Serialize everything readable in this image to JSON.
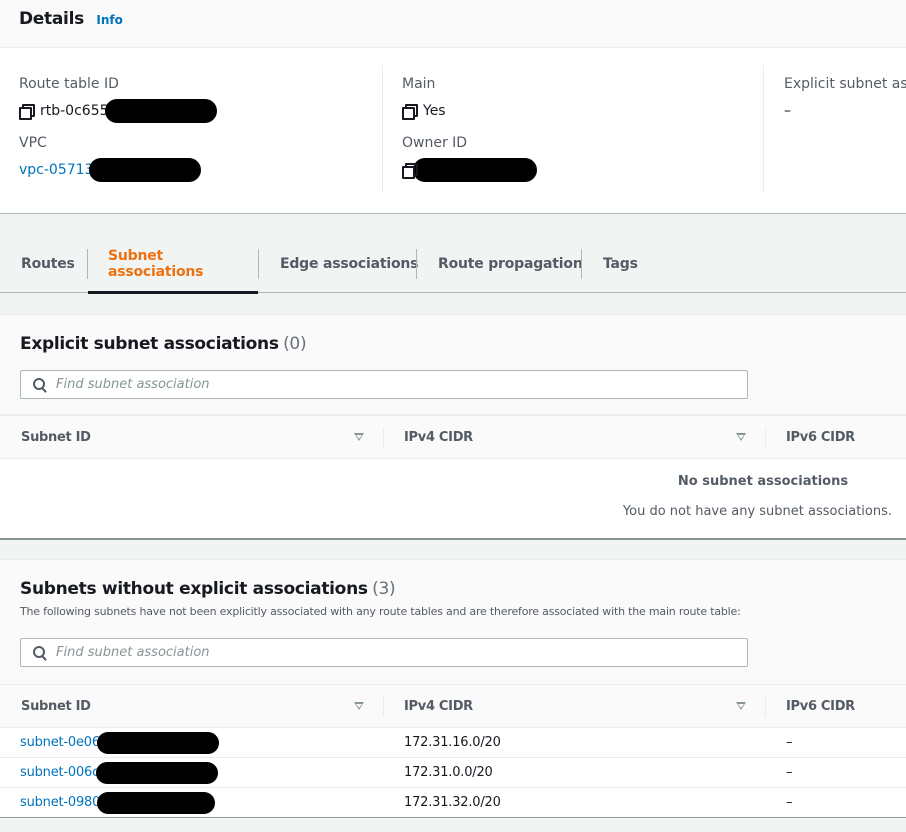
{
  "details": {
    "title": "Details",
    "info_label": "Info",
    "fields": {
      "route_table_id": {
        "label": "Route table ID",
        "value": "rtb-0c655"
      },
      "vpc": {
        "label": "VPC",
        "value": "vpc-05713"
      },
      "main": {
        "label": "Main",
        "value": "Yes"
      },
      "owner_id": {
        "label": "Owner ID",
        "value": ""
      },
      "explicit_subnet_associations": {
        "label": "Explicit subnet asso",
        "value": "–"
      }
    }
  },
  "tabs": [
    {
      "label": "Routes",
      "active": false
    },
    {
      "label": "Subnet associations",
      "active": true
    },
    {
      "label": "Edge associations",
      "active": false
    },
    {
      "label": "Route propagation",
      "active": false
    },
    {
      "label": "Tags",
      "active": false
    }
  ],
  "explicit": {
    "title": "Explicit subnet associations",
    "count": "(0)",
    "search_placeholder": "Find subnet association",
    "columns": [
      "Subnet ID",
      "IPv4 CIDR",
      "IPv6 CIDR"
    ],
    "empty_title": "No subnet associations",
    "empty_desc": "You do not have any subnet associations."
  },
  "implicit": {
    "title": "Subnets without explicit associations",
    "count": "(3)",
    "description": "The following subnets have not been explicitly associated with any route tables and are therefore associated with the main route table:",
    "search_placeholder": "Find subnet association",
    "columns": [
      "Subnet ID",
      "IPv4 CIDR",
      "IPv6 CIDR"
    ],
    "rows": [
      {
        "subnet_id": "subnet-0e06",
        "ipv4": "172.31.16.0/20",
        "ipv6": "–"
      },
      {
        "subnet_id": "subnet-006c",
        "ipv4": "172.31.0.0/20",
        "ipv6": "–"
      },
      {
        "subnet_id": "subnet-0980",
        "ipv4": "172.31.32.0/20",
        "ipv6": "–"
      }
    ]
  },
  "colors": {
    "accent_tab": "#ec7211",
    "link": "#0073bb"
  }
}
